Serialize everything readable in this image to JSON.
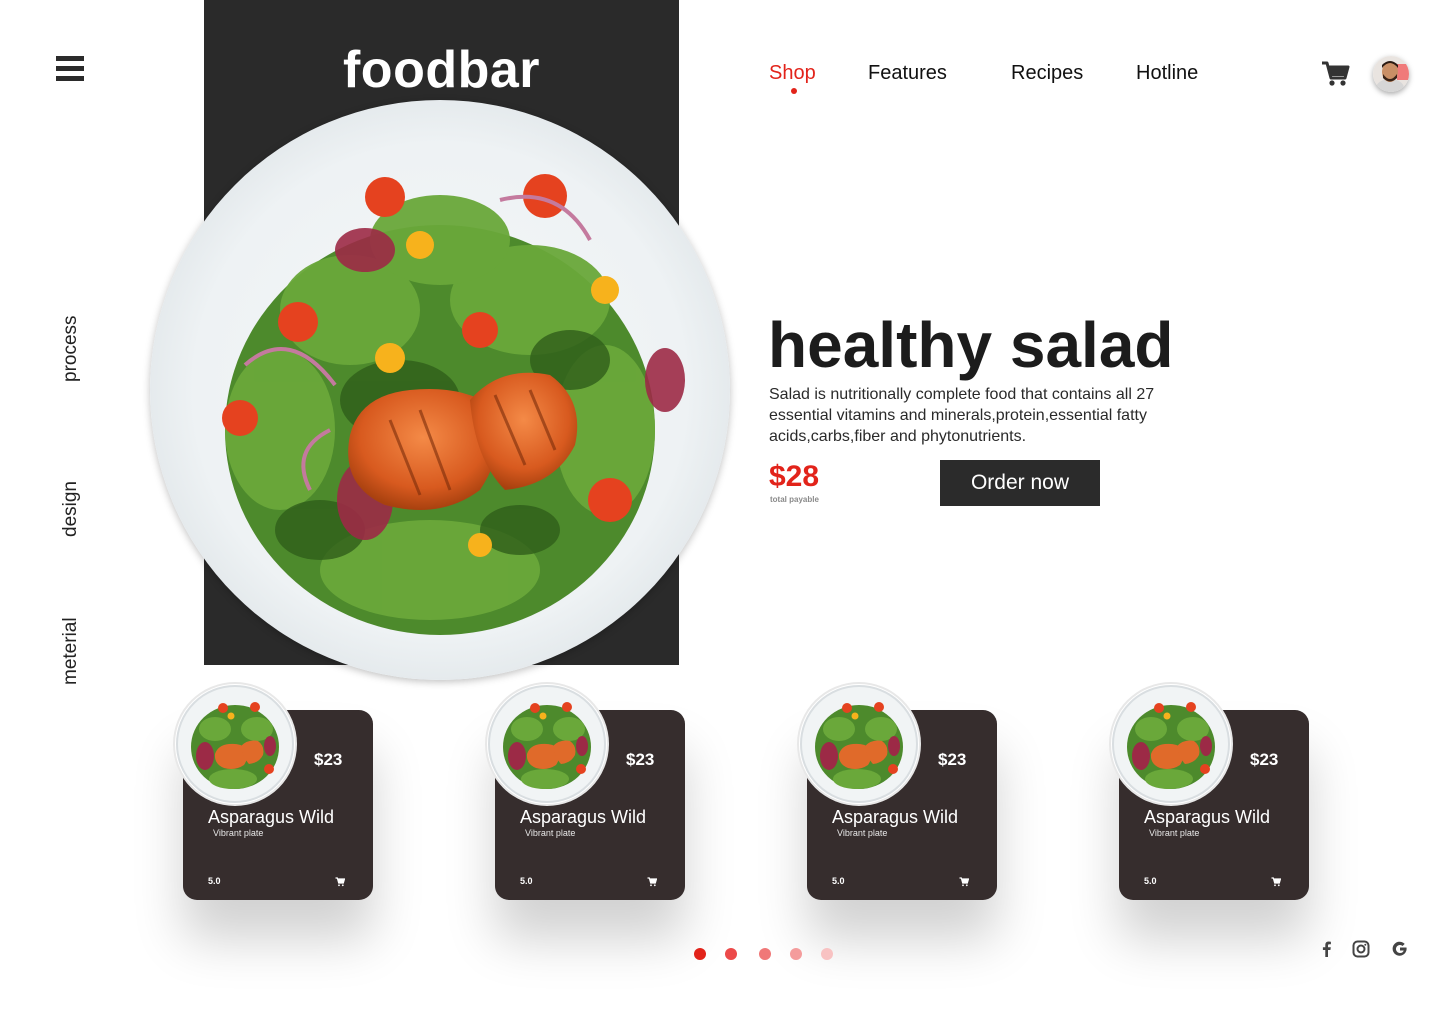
{
  "brand": {
    "name": "foodbar"
  },
  "side_nav": {
    "items": [
      "process",
      "design",
      "meterial"
    ]
  },
  "top_nav": {
    "items": [
      "Shop",
      "Features",
      "Recipes",
      "Hotline"
    ],
    "active": "Shop"
  },
  "hero": {
    "title": "healthy salad",
    "description": "Salad is nutritionally complete food that contains all 27 essential vitamins and minerals,protein,essential fatty acids,carbs,fiber and phytonutrients.",
    "price": "$28",
    "price_caption": "total payable",
    "order_label": "Order now"
  },
  "cards": [
    {
      "price": "$23",
      "name": "Asparagus Wild",
      "subtitle": "Vibrant plate",
      "rating": "5.0"
    },
    {
      "price": "$23",
      "name": "Asparagus Wild",
      "subtitle": "Vibrant plate",
      "rating": "5.0"
    },
    {
      "price": "$23",
      "name": "Asparagus Wild",
      "subtitle": "Vibrant plate",
      "rating": "5.0"
    },
    {
      "price": "$23",
      "name": "Asparagus Wild",
      "subtitle": "Vibrant plate",
      "rating": "5.0"
    }
  ],
  "pagination": {
    "count": 5,
    "active_index": 0
  },
  "icons": [
    "menu-icon",
    "cart-icon",
    "avatar",
    "facebook-icon",
    "instagram-icon",
    "google-icon"
  ],
  "colors": {
    "accent": "#e2231a",
    "dark_panel": "#2a2a2a",
    "card_bg": "#362d2d"
  }
}
